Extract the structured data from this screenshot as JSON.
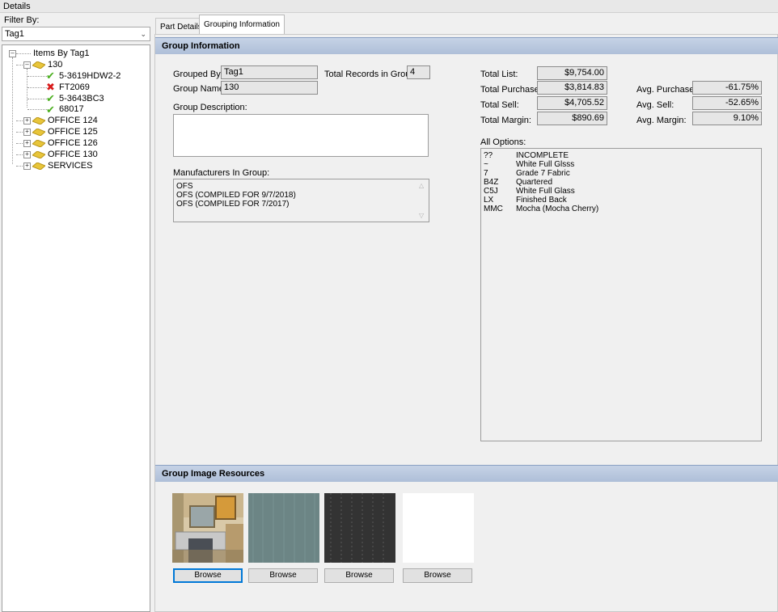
{
  "window": {
    "title": "Details"
  },
  "filter": {
    "label": "Filter By:",
    "value": "Tag1"
  },
  "tree": {
    "root": "Items By Tag1",
    "groups": [
      {
        "label": "130",
        "expanded": true,
        "children": [
          {
            "label": "5-3619HDW2-2",
            "status": "ok"
          },
          {
            "label": "FT2069",
            "status": "error"
          },
          {
            "label": "5-3643BC3",
            "status": "ok"
          },
          {
            "label": "68017",
            "status": "ok"
          }
        ]
      },
      {
        "label": "OFFICE 124"
      },
      {
        "label": "OFFICE 125"
      },
      {
        "label": "OFFICE 126"
      },
      {
        "label": "OFFICE 130"
      },
      {
        "label": "SERVICES"
      }
    ]
  },
  "tabs": [
    {
      "label": "Part Details",
      "active": false
    },
    {
      "label": "Grouping Information",
      "active": true
    }
  ],
  "group_info": {
    "header": "Group Information",
    "grouped_by_label": "Grouped By:",
    "grouped_by_value": "Tag1",
    "total_records_label": "Total Records in Group:",
    "total_records_value": "4",
    "group_name_label": "Group Name:",
    "group_name_value": "130",
    "group_description_label": "Group Description:",
    "group_description_value": "",
    "manufacturers_label": "Manufacturers In Group:",
    "manufacturers": [
      "OFS",
      "OFS (COMPILED FOR 9/7/2018)",
      "OFS (COMPILED FOR 7/2017)"
    ]
  },
  "totals": {
    "total_list_label": "Total List:",
    "total_list": "$9,754.00",
    "total_purchase_label": "Total Purchase:",
    "total_purchase": "$3,814.83",
    "total_sell_label": "Total Sell:",
    "total_sell": "$4,705.52",
    "total_margin_label": "Total Margin:",
    "total_margin": "$890.69",
    "avg_purchase_label": "Avg. Purchase:",
    "avg_purchase": "-61.75%",
    "avg_sell_label": "Avg. Sell:",
    "avg_sell": "-52.65%",
    "avg_margin_label": "Avg. Margin:",
    "avg_margin": "9.10%"
  },
  "all_options": {
    "label": "All Options:",
    "items": [
      {
        "code": "??",
        "desc": "INCOMPLETE"
      },
      {
        "code": "~",
        "desc": "White Full Glsss"
      },
      {
        "code": "7",
        "desc": "Grade 7 Fabric"
      },
      {
        "code": "B4Z",
        "desc": "Quartered"
      },
      {
        "code": "C5J",
        "desc": "White Full Glass"
      },
      {
        "code": "LX",
        "desc": "Finished Back"
      },
      {
        "code": "MMC",
        "desc": "Mocha (Mocha Cherry)"
      }
    ]
  },
  "image_resources": {
    "header": "Group Image Resources",
    "browse_label": "Browse",
    "browse_buttons": [
      "Browse",
      "Browse",
      "Browse",
      "Browse"
    ]
  },
  "colors": {
    "section_header": "#b9c8de",
    "ok_check": "#4caf20",
    "error_x": "#d81c1c",
    "folder": "#e8c53a"
  }
}
